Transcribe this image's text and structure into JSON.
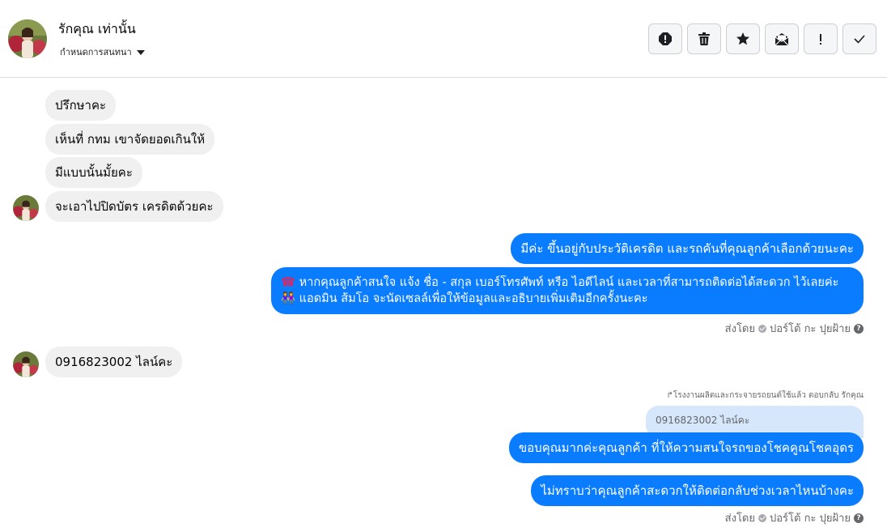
{
  "header": {
    "contact_name": "รักคุณ เท่านั้น",
    "assign_label": "กำหนดการสนทนา"
  },
  "toolbar": [
    {
      "name": "spam-button",
      "icon": "alert-octagon-icon"
    },
    {
      "name": "delete-button",
      "icon": "trash-icon"
    },
    {
      "name": "star-button",
      "icon": "star-icon"
    },
    {
      "name": "mark-unread-button",
      "icon": "envelope-open-icon"
    },
    {
      "name": "follow-up-button",
      "icon": "exclamation-icon",
      "label": "!"
    },
    {
      "name": "done-button",
      "icon": "check-icon"
    }
  ],
  "messages": [
    {
      "dir": "in",
      "text": "ปรึกษาคะ"
    },
    {
      "dir": "in",
      "text": "เห็นที่ กทม เขาจัดยอดเกินให้"
    },
    {
      "dir": "in",
      "text": "มีแบบนั้นมั้ยคะ"
    },
    {
      "dir": "in",
      "text": "จะเอาไปปิดบัตร เครดิตด้วยคะ"
    },
    {
      "dir": "out",
      "text": "มีค่ะ ขึ้นอยู่กับประวัติเครดิต และรถคันที่คุณลูกค้าเลือกด้วยนะคะ"
    },
    {
      "dir": "out",
      "line1": "หากคุณลูกค้าสนใจ แจ้ง ชื่อ - สกุล เบอร์โทรศัพท์ หรือ ไอดีไลน์ และเวลาที่สามารถติดต่อได้สะดวก ไว้เลยค่ะ",
      "line2": "แอดมิน ส้มโอ จะนัดเซลล์เพื่อให้ข้อมูลและอธิบายเพิ่มเติมอีกครั้งนะคะ",
      "emoji1": "☎",
      "emoji2": "👭"
    },
    {
      "dir": "in",
      "text": "0916823002 ไลน์คะ"
    },
    {
      "dir": "out",
      "text": "ขอบคุณมากค่ะคุณลูกค้า ที่ให้ความสนใจรถของโชคคูณโชคอุดร"
    },
    {
      "dir": "out",
      "text": "ไม่ทราบว่าคุณลูกค้าสะดวกให้ติดต่อกลับช่วงเวลาไหนบ้างคะ"
    }
  ],
  "sent_by": {
    "prefix": "ส่งโดย",
    "name": "ปอร์โต้ กะ ปุยฝ้าย"
  },
  "reply": {
    "note": "โรงงานผลิตและกระจายรถยนต์ใช้แล้ว ตอบกลับ รักคุณ",
    "quoted_text": "0916823002 ไลน์คะ"
  },
  "colors": {
    "outgoing": "#0a7cff",
    "incoming": "#f0f0f0"
  }
}
